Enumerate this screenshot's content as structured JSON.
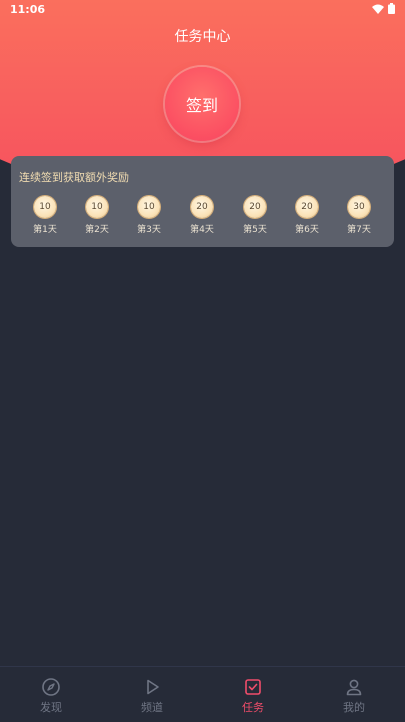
{
  "status_bar": {
    "time": "11:06",
    "icons": [
      "wifi-icon",
      "battery-icon"
    ]
  },
  "header": {
    "title": "任务中心"
  },
  "sign_in": {
    "label": "签到",
    "color": "#fb4f62"
  },
  "reward": {
    "title": "连续签到获取额外奖励",
    "days": [
      {
        "coins": "10",
        "label": "第1天"
      },
      {
        "coins": "10",
        "label": "第2天"
      },
      {
        "coins": "10",
        "label": "第3天"
      },
      {
        "coins": "20",
        "label": "第4天"
      },
      {
        "coins": "20",
        "label": "第5天"
      },
      {
        "coins": "20",
        "label": "第6天"
      },
      {
        "coins": "30",
        "label": "第7天"
      }
    ]
  },
  "nav": {
    "items": [
      {
        "label": "发现",
        "icon": "compass-icon",
        "active": false
      },
      {
        "label": "频道",
        "icon": "play-icon",
        "active": false
      },
      {
        "label": "任务",
        "icon": "task-icon",
        "active": true
      },
      {
        "label": "我的",
        "icon": "user-icon",
        "active": false
      }
    ],
    "active_color": "#f04d6a",
    "inactive_color": "#6f7584"
  }
}
